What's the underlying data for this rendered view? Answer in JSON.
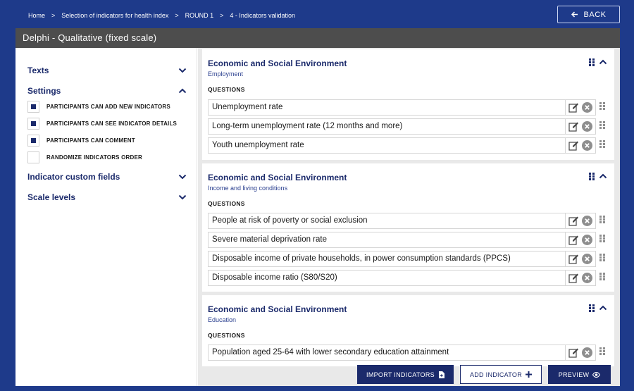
{
  "breadcrumb": [
    "Home",
    "Selection of indicators for health index",
    "ROUND 1",
    "4 - Indicators validation"
  ],
  "back_label": "BACK",
  "panel_title": "Delphi - Qualitative (fixed scale)",
  "sidebar": {
    "texts": "Texts",
    "settings": "Settings",
    "options": [
      {
        "label": "PARTICIPANTS CAN ADD NEW INDICATORS",
        "checked": true
      },
      {
        "label": "PARTICIPANTS CAN SEE INDICATOR DETAILS",
        "checked": true
      },
      {
        "label": "PARTICIPANTS CAN COMMENT",
        "checked": true
      },
      {
        "label": "RANDOMIZE INDICATORS ORDER",
        "checked": false
      }
    ],
    "custom_fields": "Indicator custom fields",
    "scale_levels": "Scale levels"
  },
  "cards": [
    {
      "title": "Economic and Social Environment",
      "subtitle": "Employment",
      "questions_label": "QUESTIONS",
      "questions": [
        "Unemployment rate",
        "Long-term unemployment rate (12 months and more)",
        "Youth unemployment rate"
      ]
    },
    {
      "title": "Economic and Social Environment",
      "subtitle": "Income and living conditions",
      "questions_label": "QUESTIONS",
      "questions": [
        "People at risk of poverty or social exclusion",
        "Severe material deprivation rate",
        "Disposable income of private households, in power consumption standards (PPCS)",
        "Disposable income ratio (S80/S20)"
      ]
    },
    {
      "title": "Economic and Social Environment",
      "subtitle": "Education",
      "questions_label": "QUESTIONS",
      "questions": [
        "Population aged 25-64 with lower secondary education attainment"
      ]
    }
  ],
  "footer": {
    "import": "IMPORT INDICATORS",
    "add": "ADD INDICATOR",
    "preview": "PREVIEW"
  },
  "colors": {
    "brand": "#1b2a6b",
    "background": "#1e3a8a",
    "title_bar": "#4d4d4d"
  }
}
